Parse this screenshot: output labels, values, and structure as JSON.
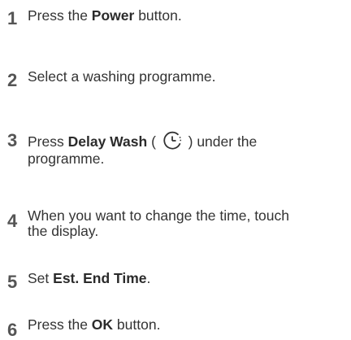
{
  "steps": [
    {
      "number": "1",
      "pre": "Press the ",
      "bold": "Power",
      "post": " button."
    },
    {
      "number": "2",
      "text": "Select a washing programme."
    },
    {
      "number": "3",
      "pre": "Press ",
      "bold": "Delay Wash",
      "mid": " ( ",
      "icon": "clock-icon",
      "post": " ) under the",
      "line2": "programme."
    },
    {
      "number": "4",
      "line1": "When you want to change the time, touch",
      "line2": "the display."
    },
    {
      "number": "5",
      "pre": "Set ",
      "bold": "Est. End Time",
      "post": "."
    },
    {
      "number": "6",
      "pre": "Press the ",
      "bold": "OK",
      "post": " button."
    }
  ]
}
